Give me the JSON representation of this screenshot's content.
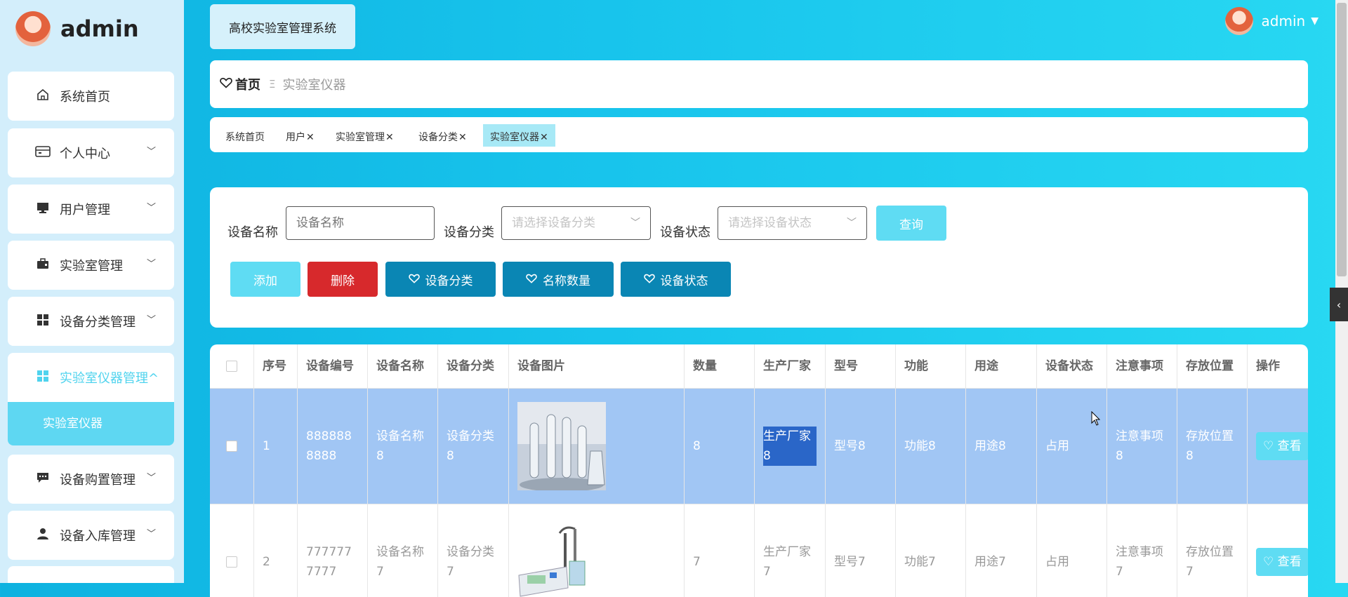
{
  "sidebar": {
    "brand": "admin",
    "menu": [
      {
        "label": "系统首页"
      },
      {
        "label": "个人中心"
      },
      {
        "label": "用户管理"
      },
      {
        "label": "实验室管理"
      },
      {
        "label": "设备分类管理"
      },
      {
        "label": "实验室仪器管理^"
      },
      {
        "label": "设备购置管理"
      },
      {
        "label": "设备入库管理"
      }
    ],
    "submenu_active": "实验室仪器"
  },
  "header": {
    "system_title": "高校实验室管理系统",
    "username": "admin"
  },
  "breadcrumb": {
    "home": "首页",
    "separator": "Ξ",
    "current": "实验室仪器"
  },
  "tags": [
    "系统首页",
    "用户",
    "实验室管理",
    "设备分类",
    "实验室仪器"
  ],
  "filters": {
    "name_label": "设备名称",
    "name_placeholder": "设备名称",
    "category_label": "设备分类",
    "category_placeholder": "请选择设备分类",
    "status_label": "设备状态",
    "status_placeholder": "请选择设备状态",
    "query_button": "查询"
  },
  "actions": {
    "add": "添加",
    "delete": "删除",
    "category_stat": "设备分类",
    "name_qty_stat": "名称数量",
    "status_stat": "设备状态"
  },
  "table": {
    "columns": [
      "序号",
      "设备编号",
      "设备名称",
      "设备分类",
      "设备图片",
      "数量",
      "生产厂家",
      "型号",
      "功能",
      "用途",
      "设备状态",
      "注意事项",
      "存放位置",
      "操作"
    ],
    "rows": [
      {
        "index": "1",
        "code": "8888888888",
        "name": "设备名称8",
        "category": "设备分类8",
        "quantity": "8",
        "manufacturer": "生产厂家8",
        "model": "型号8",
        "function": "功能8",
        "usage": "用途8",
        "status": "占用",
        "notes": "注意事项8",
        "location": "存放位置8",
        "view": "查看"
      },
      {
        "index": "2",
        "code": "7777777777",
        "name": "设备名称7",
        "category": "设备分类7",
        "quantity": "7",
        "manufacturer": "生产厂家7",
        "model": "型号7",
        "function": "功能7",
        "usage": "用途7",
        "status": "占用",
        "notes": "注意事项7",
        "location": "存放位置7",
        "view": "查看"
      }
    ]
  },
  "colors": {
    "accent": "#5fdcf3",
    "danger": "#d7292c",
    "primary_dark": "#0a86b4",
    "selected_row": "#a1c6f4"
  }
}
